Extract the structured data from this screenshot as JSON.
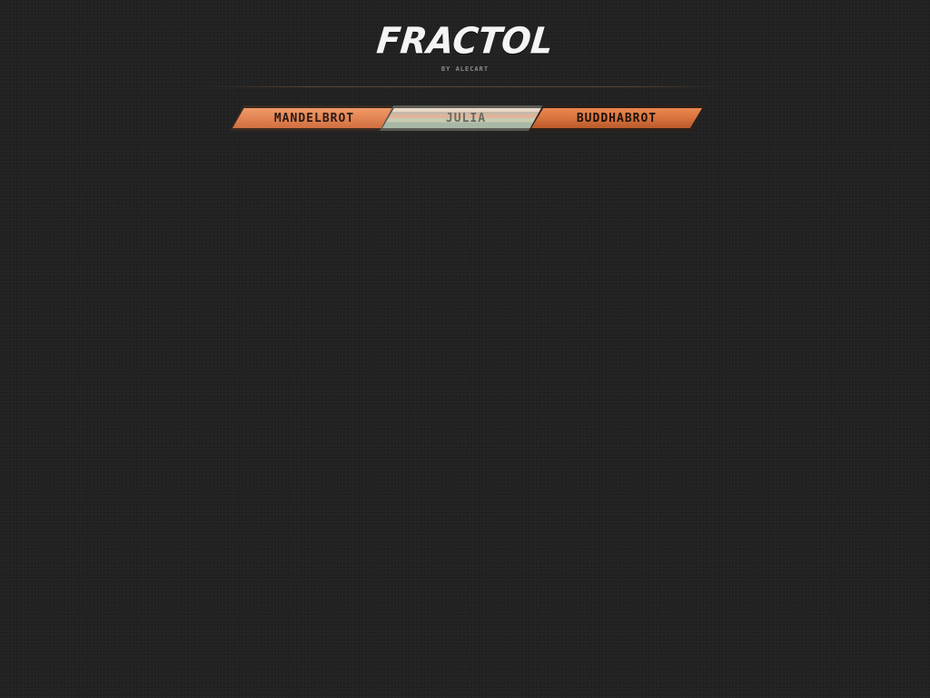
{
  "header": {
    "title": "FRACTOL",
    "byline": "BY ALECART"
  },
  "tabs": [
    {
      "label": "MANDELBROT"
    },
    {
      "label": "JULIA"
    },
    {
      "label": "BUDDHABROT"
    }
  ],
  "colors": {
    "background": "#222222",
    "tab_orange": "#e38455",
    "tab_orange_dark": "#d9733e",
    "tab_julia": "#c6cbb0",
    "divider": "#785538"
  }
}
